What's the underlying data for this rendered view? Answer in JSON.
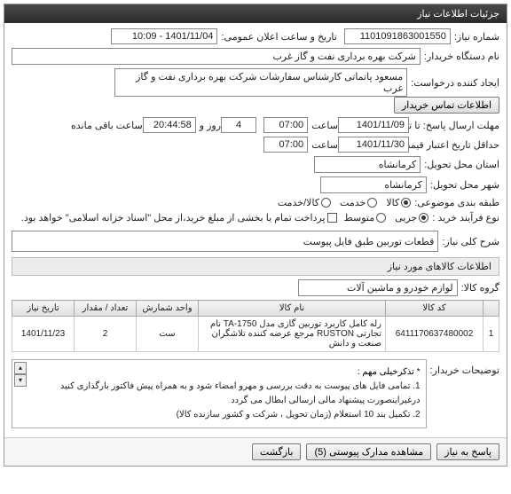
{
  "header": {
    "title": "جزئیات اطلاعات نیاز"
  },
  "fields": {
    "need_no_lbl": "شماره نیاز:",
    "need_no": "1101091863001550",
    "announce_lbl": "تاریخ و ساعت اعلان عمومی:",
    "announce": "1401/11/04 - 10:09",
    "buyer_lbl": "نام دستگاه خریدار:",
    "buyer": "شرکت بهره برداری نفت و گاز غرب",
    "creator_lbl": "ایجاد کننده درخواست:",
    "creator": "مسعود پاتماتی کارشناس سفارشات شرکت بهره برداری نفت و گاز غرب",
    "contact_btn": "اطلاعات تماس خریدار",
    "deadline_lbl": "مهلت ارسال پاسخ: تا تاریخ:",
    "deadline_date": "1401/11/09",
    "time_lbl": "ساعت",
    "deadline_time": "07:00",
    "days_remain": "4",
    "days_and": "روز و",
    "time_remain": "20:44:58",
    "remain_suffix": "ساعت باقی مانده",
    "validity_lbl": "حداقل تاریخ اعتبار قیمت: تا تاریخ:",
    "validity_date": "1401/11/30",
    "validity_time": "07:00",
    "province_lbl": "استان محل تحویل:",
    "province": "کرمانشاه",
    "city_lbl": "شهر محل تحویل:",
    "city": "کرمانشاه",
    "class_lbl": "طبقه بندی موضوعی:",
    "r_goods": "کالا",
    "r_service": "خدمت",
    "r_goods_service": "کالا/خدمت",
    "proc_lbl": "نوع فرآیند خرید :",
    "r_small": "جزیی",
    "r_medium": "متوسط",
    "proc_note": "پرداخت تمام یا بخشی از مبلغ خرید،از محل \"اسناد خزانه اسلامی\" خواهد بود.",
    "desc_lbl": "شرح کلی نیاز:",
    "desc": "قطعات توربین طبق فایل پیوست"
  },
  "goods": {
    "title": "اطلاعات کالاهای مورد نیاز",
    "group_lbl": "گروه کالا:",
    "group": "لوازم خودرو و ماشین آلات",
    "cols": [
      "",
      "کد کالا",
      "نام کالا",
      "واحد شمارش",
      "تعداد / مقدار",
      "تاریخ نیاز"
    ],
    "row": {
      "n": "1",
      "code": "6411170637480002",
      "name": "رله کامل کاربرد توربین گازی مدل TA-1750 نام تجارتی RUSTON مرجع عرضه کننده تلاشگران صنعت و دانش",
      "unit": "ست",
      "qty": "2",
      "date": "1401/11/23"
    }
  },
  "buyer_notes": {
    "lbl": "توضیحات خریدار:",
    "star": "* تذکرخیلی مهم :",
    "line1": "1. تمامی فایل های پیوست به دقت بررسی و مهرو امضاء شود و به همراه پیش فاکتور بارگذاری کنید درغیراینصورت پیشنهاد مالی ارسالی ابطال می گردد",
    "line2": "2. تکمیل بند 10 استعلام (زمان تحویل ، شرکت و کشور سازنده کالا)"
  },
  "footer": {
    "reply": "پاسخ به نیاز",
    "attach": "مشاهده مدارک پیوستی (5)",
    "back": "بازگشت"
  }
}
